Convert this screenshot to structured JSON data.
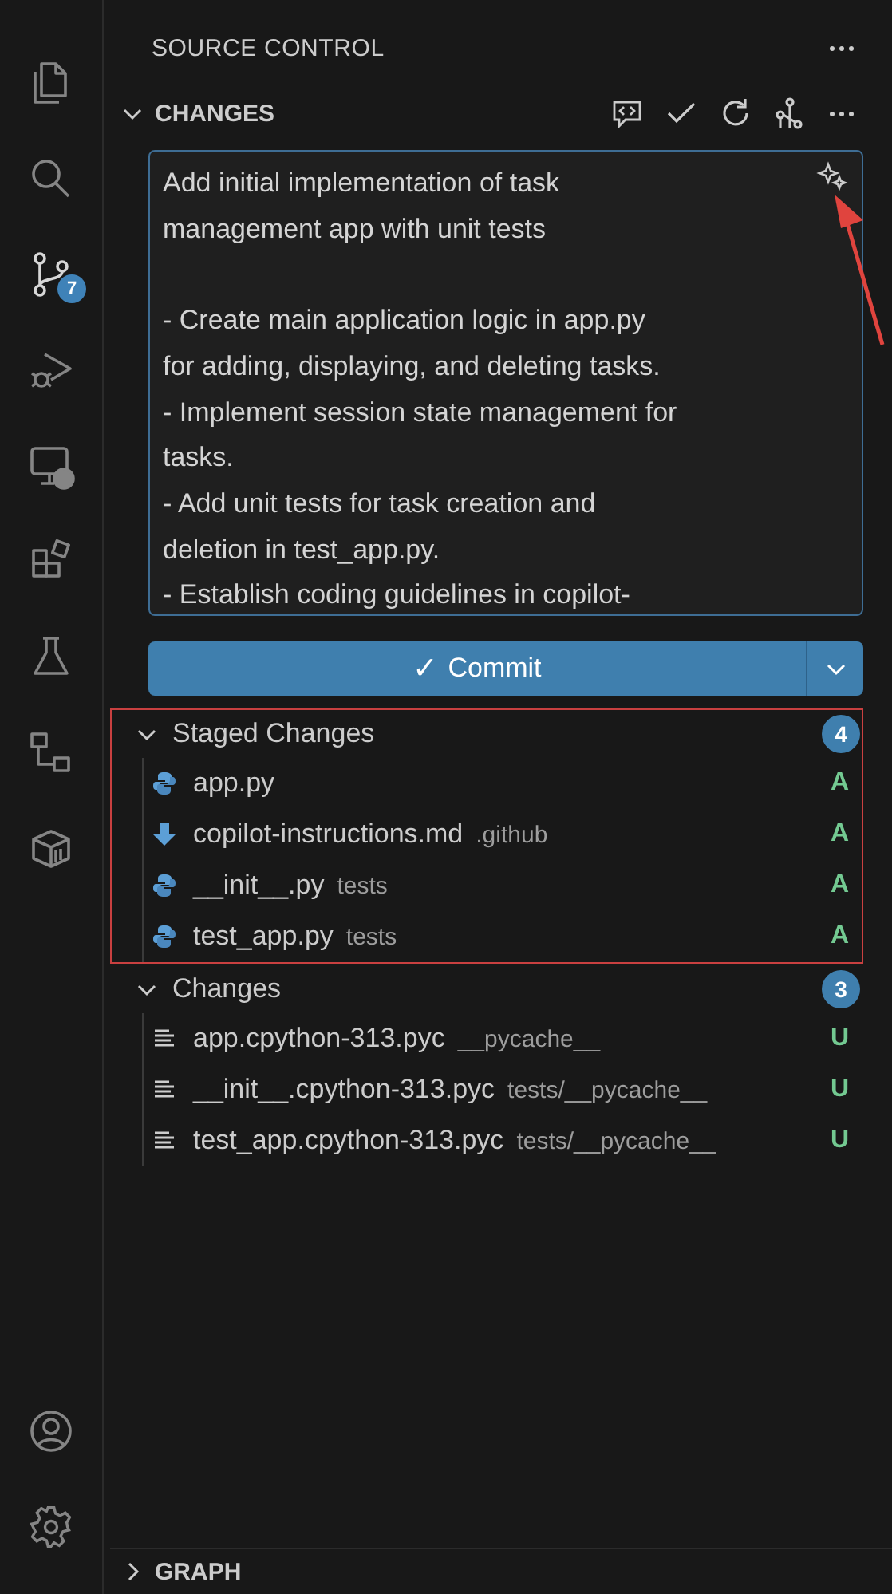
{
  "activity_bar": {
    "items": [
      {
        "selected": false
      },
      {
        "selected": false
      },
      {
        "selected": true,
        "badge": "7"
      },
      {
        "selected": false
      },
      {
        "selected": false
      },
      {
        "selected": false
      },
      {
        "selected": false
      },
      {
        "selected": false
      },
      {
        "selected": false
      }
    ],
    "bottom_items": [
      {
        "selected": false
      },
      {
        "selected": false
      }
    ]
  },
  "panel": {
    "title": "SOURCE CONTROL",
    "section": "CHANGES",
    "expanded": true
  },
  "commit_message": {
    "value": "Add initial implementation of task\nmanagement app with unit tests\n\n- Create main application logic in app.py\nfor adding, displaying, and deleting tasks.\n- Implement session state management for\ntasks.\n- Add unit tests for task creation and\ndeletion in test_app.py.\n- Establish coding guidelines in copilot-",
    "pointer": true
  },
  "commit_button": {
    "label": "Commit",
    "check": "✓"
  },
  "groups": [
    {
      "title": "Staged Changes",
      "count": "4",
      "expanded": true,
      "highlighted": true,
      "files": [
        {
          "kind": "python",
          "name": "app.py",
          "status": "A"
        },
        {
          "kind": "markdown",
          "name": "copilot-instructions.md",
          "dir": ".github",
          "status": "A"
        },
        {
          "kind": "python",
          "name": "__init__.py",
          "dir": "tests",
          "status": "A"
        },
        {
          "kind": "python",
          "name": "test_app.py",
          "dir": "tests",
          "status": "A"
        }
      ]
    },
    {
      "title": "Changes",
      "count": "3",
      "expanded": true,
      "highlighted": false,
      "files": [
        {
          "kind": "binary",
          "name": "app.cpython-313.pyc",
          "dir": "__pycache__",
          "status": "U"
        },
        {
          "kind": "binary",
          "name": "__init__.cpython-313.pyc",
          "dir": "tests/__pycache__",
          "status": "U"
        },
        {
          "kind": "binary",
          "name": "test_app.cpython-313.pyc",
          "dir": "tests/__pycache__",
          "status": "U"
        }
      ]
    }
  ],
  "graph": {
    "title": "GRAPH",
    "expanded": false
  }
}
